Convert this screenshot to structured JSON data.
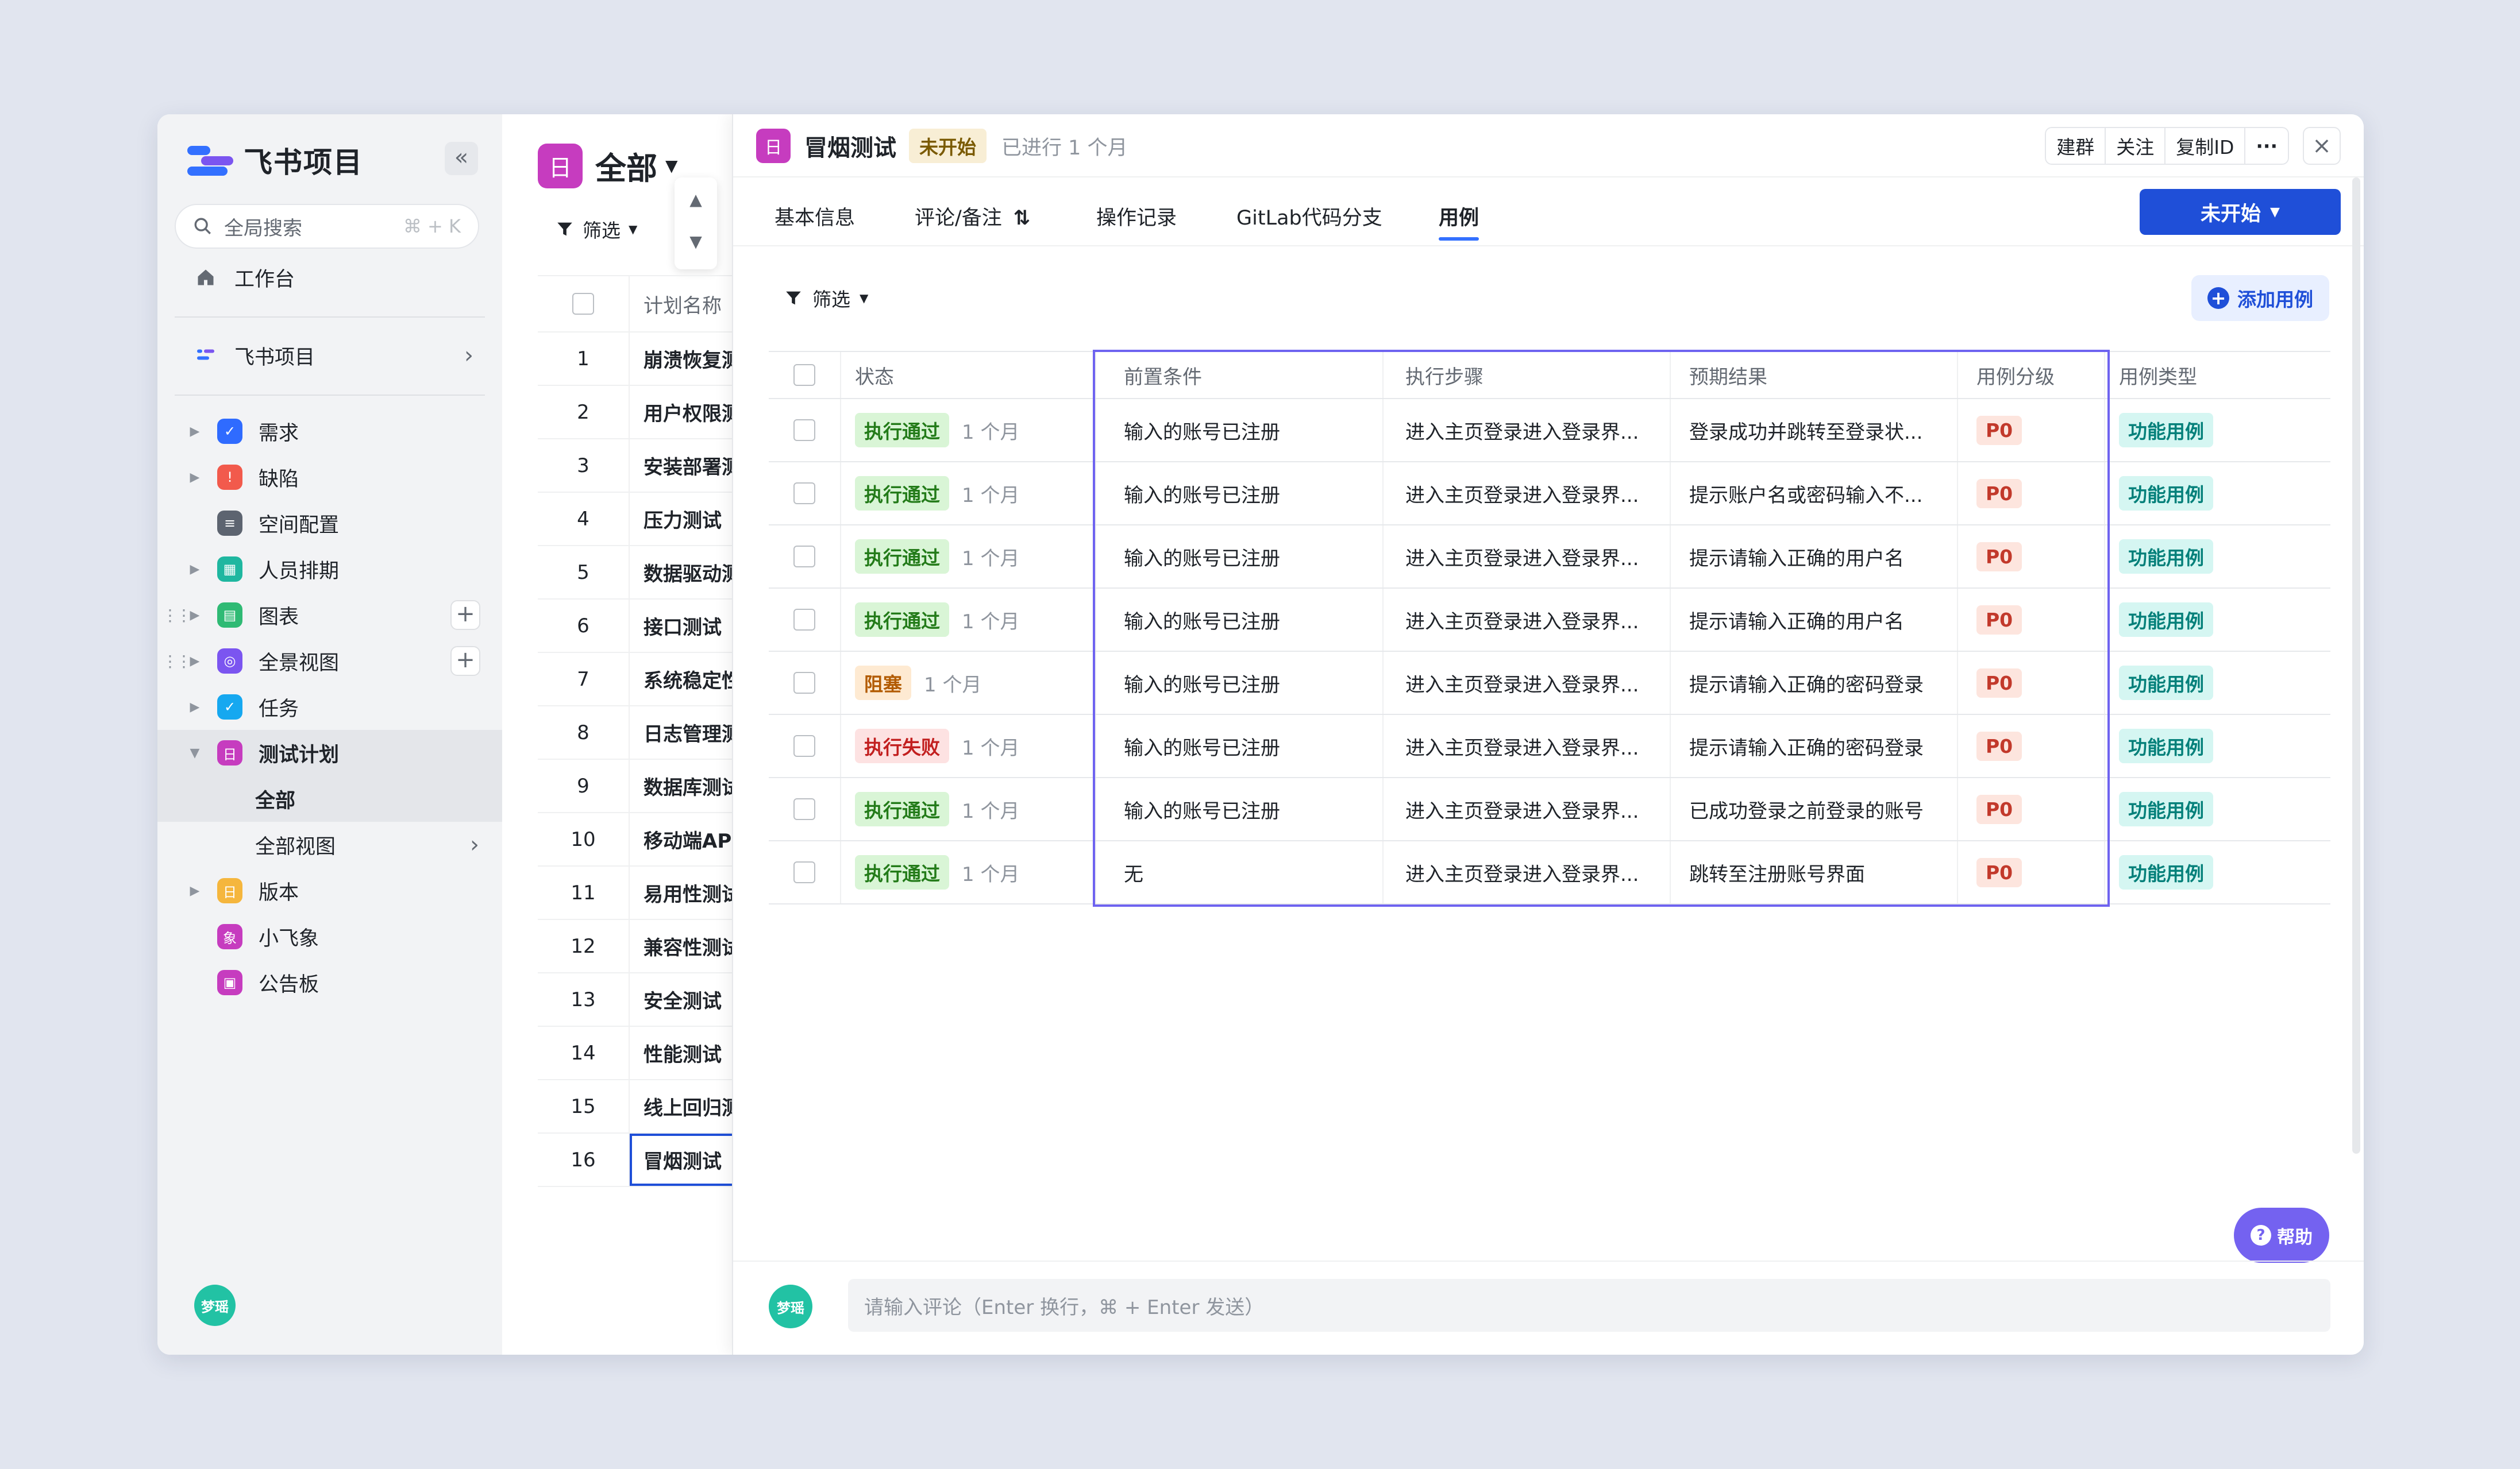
{
  "sidebar": {
    "app_title": "飞书项目",
    "search_placeholder": "全局搜索",
    "search_shortcut": "⌘ + K",
    "workbench": "工作台",
    "project": "飞书项目",
    "modules": [
      {
        "label": "需求",
        "color": "#2f6bff",
        "glyph": "✓"
      },
      {
        "label": "缺陷",
        "color": "#f25a4c",
        "glyph": "!"
      },
      {
        "label": "空间配置",
        "color": "#5d6470",
        "glyph": "≡"
      },
      {
        "label": "人员排期",
        "color": "#1fb7a0",
        "glyph": "▦"
      },
      {
        "label": "图表",
        "color": "#2fba74",
        "glyph": "▤"
      },
      {
        "label": "全景视图",
        "color": "#7b55f0",
        "glyph": "◎"
      },
      {
        "label": "任务",
        "color": "#16a8f0",
        "glyph": "✓"
      },
      {
        "label": "测试计划",
        "color": "#c63cbf",
        "glyph": "日"
      }
    ],
    "sub_items": [
      "全部",
      "全部视图"
    ],
    "more_modules": [
      {
        "label": "版本",
        "color": "#f5b63d",
        "glyph": "日"
      },
      {
        "label": "小飞象",
        "color": "#c63cbf",
        "glyph": "象"
      },
      {
        "label": "公告板",
        "color": "#c63cbf",
        "glyph": "▣"
      }
    ],
    "user_avatar": "梦瑶"
  },
  "list": {
    "title": "全部",
    "filter": "筛选",
    "column_header": "计划名称",
    "rows": [
      {
        "num": "1",
        "name": "崩溃恢复测"
      },
      {
        "num": "2",
        "name": "用户权限测"
      },
      {
        "num": "3",
        "name": "安装部署测"
      },
      {
        "num": "4",
        "name": "压力测试"
      },
      {
        "num": "5",
        "name": "数据驱动测"
      },
      {
        "num": "6",
        "name": "接口测试"
      },
      {
        "num": "7",
        "name": "系统稳定性"
      },
      {
        "num": "8",
        "name": "日志管理测"
      },
      {
        "num": "9",
        "name": "数据库测试"
      },
      {
        "num": "10",
        "name": "移动端API"
      },
      {
        "num": "11",
        "name": "易用性测试"
      },
      {
        "num": "12",
        "name": "兼容性测试"
      },
      {
        "num": "13",
        "name": "安全测试"
      },
      {
        "num": "14",
        "name": "性能测试"
      },
      {
        "num": "15",
        "name": "线上回归测"
      },
      {
        "num": "16",
        "name": "冒烟测试"
      }
    ]
  },
  "detail": {
    "title": "冒烟测试",
    "status": "未开始",
    "elapsed": "已进行 1 个月",
    "actions": [
      "建群",
      "关注",
      "复制ID"
    ],
    "tabs": [
      "基本信息",
      "评论/备注",
      "操作记录",
      "GitLab代码分支",
      "用例"
    ],
    "active_tab": "用例",
    "status_button": "未开始",
    "filter": "筛选",
    "add_case": "添加用例",
    "columns": [
      "状态",
      "前置条件",
      "执行步骤",
      "预期结果",
      "用例分级",
      "用例类型"
    ],
    "cases": [
      {
        "state": "执行通过",
        "kind": "pass",
        "ago": "1 个月",
        "pre": "输入的账号已注册",
        "step": "进入主页登录进入登录界...",
        "expect": "登录成功并跳转至登录状...",
        "level": "P0",
        "type": "功能用例"
      },
      {
        "state": "执行通过",
        "kind": "pass",
        "ago": "1 个月",
        "pre": "输入的账号已注册",
        "step": "进入主页登录进入登录界...",
        "expect": "提示账户名或密码输入不...",
        "level": "P0",
        "type": "功能用例"
      },
      {
        "state": "执行通过",
        "kind": "pass",
        "ago": "1 个月",
        "pre": "输入的账号已注册",
        "step": "进入主页登录进入登录界...",
        "expect": "提示请输入正确的用户名",
        "level": "P0",
        "type": "功能用例"
      },
      {
        "state": "执行通过",
        "kind": "pass",
        "ago": "1 个月",
        "pre": "输入的账号已注册",
        "step": "进入主页登录进入登录界...",
        "expect": "提示请输入正确的用户名",
        "level": "P0",
        "type": "功能用例"
      },
      {
        "state": "阻塞",
        "kind": "block",
        "ago": "1 个月",
        "pre": "输入的账号已注册",
        "step": "进入主页登录进入登录界...",
        "expect": "提示请输入正确的密码登录",
        "level": "P0",
        "type": "功能用例"
      },
      {
        "state": "执行失败",
        "kind": "fail",
        "ago": "1 个月",
        "pre": "输入的账号已注册",
        "step": "进入主页登录进入登录界...",
        "expect": "提示请输入正确的密码登录",
        "level": "P0",
        "type": "功能用例"
      },
      {
        "state": "执行通过",
        "kind": "pass",
        "ago": "1 个月",
        "pre": "输入的账号已注册",
        "step": "进入主页登录进入登录界...",
        "expect": "已成功登录之前登录的账号",
        "level": "P0",
        "type": "功能用例"
      },
      {
        "state": "执行通过",
        "kind": "pass",
        "ago": "1 个月",
        "pre": "无",
        "step": "进入主页登录进入登录界...",
        "expect": "跳转至注册账号界面",
        "level": "P0",
        "type": "功能用例"
      }
    ],
    "help": "帮助",
    "comment_placeholder": "请输入评论（Enter 换行，⌘ + Enter 发送）",
    "commenter": "梦瑶"
  },
  "colors": {
    "accent": "#1f4fd8",
    "selection": "#6e63f0",
    "plan": "#c63cbf"
  }
}
